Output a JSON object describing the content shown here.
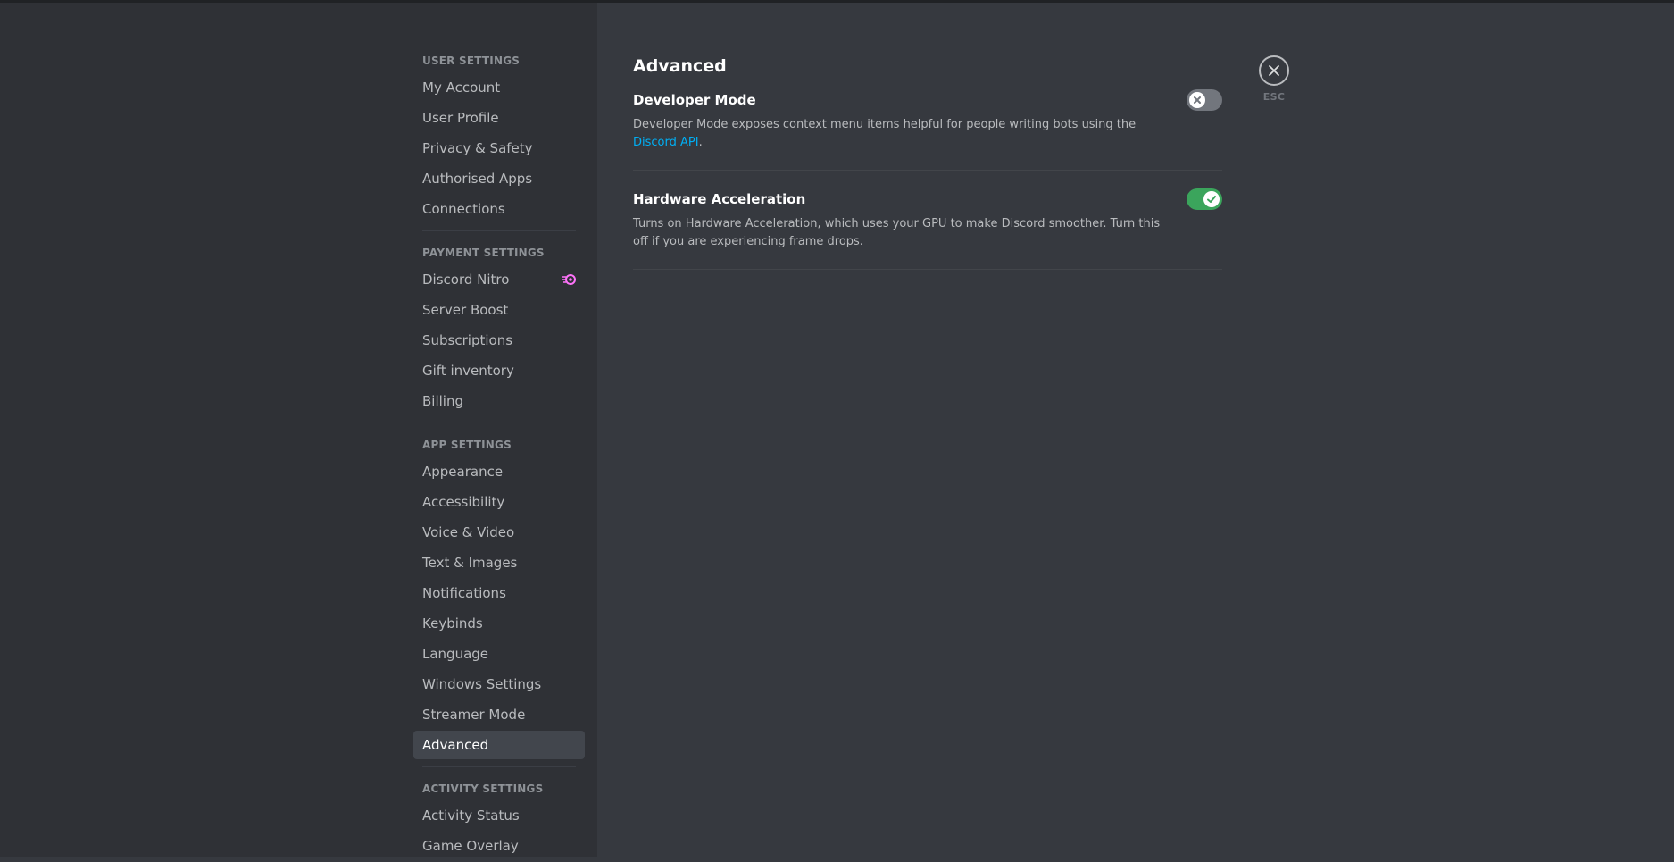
{
  "sidebar": {
    "sections": [
      {
        "header": "User Settings",
        "items": [
          "My Account",
          "User Profile",
          "Privacy & Safety",
          "Authorised Apps",
          "Connections"
        ]
      },
      {
        "header": "Payment Settings",
        "items": [
          "Discord Nitro",
          "Server Boost",
          "Subscriptions",
          "Gift inventory",
          "Billing"
        ]
      },
      {
        "header": "App Settings",
        "items": [
          "Appearance",
          "Accessibility",
          "Voice & Video",
          "Text & Images",
          "Notifications",
          "Keybinds",
          "Language",
          "Windows Settings",
          "Streamer Mode",
          "Advanced"
        ]
      },
      {
        "header": "Activity Settings",
        "items": [
          "Activity Status",
          "Game Overlay"
        ]
      }
    ],
    "selected": "Advanced",
    "nitro_icon": "nitro-icon"
  },
  "main": {
    "title": "Advanced",
    "settings": [
      {
        "title": "Developer Mode",
        "description_prefix": "Developer Mode exposes context menu items helpful for people writing bots using the ",
        "link_text": "Discord API",
        "description_suffix": ".",
        "enabled": false
      },
      {
        "title": "Hardware Acceleration",
        "description": "Turns on Hardware Acceleration, which uses your GPU to make Discord smoother. Turn this off if you are experiencing frame drops.",
        "enabled": true
      }
    ]
  },
  "close": {
    "label": "ESC",
    "icon": "close-icon"
  },
  "colors": {
    "toggle_on": "#3ba55c",
    "toggle_off": "#72767d",
    "link": "#00aff4",
    "nitro": "#ff73fa"
  }
}
